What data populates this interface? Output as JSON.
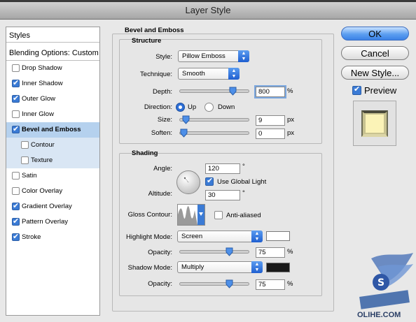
{
  "window": {
    "title": "Layer Style"
  },
  "styles_list": {
    "header": "Styles",
    "blending": "Blending Options: Custom",
    "items": [
      {
        "label": "Drop Shadow",
        "checked": false
      },
      {
        "label": "Inner Shadow",
        "checked": true
      },
      {
        "label": "Outer Glow",
        "checked": true
      },
      {
        "label": "Inner Glow",
        "checked": false
      },
      {
        "label": "Bevel and Emboss",
        "checked": true,
        "selected": true
      },
      {
        "label": "Contour",
        "checked": false,
        "sub": true
      },
      {
        "label": "Texture",
        "checked": false,
        "sub": true
      },
      {
        "label": "Satin",
        "checked": false
      },
      {
        "label": "Color Overlay",
        "checked": false
      },
      {
        "label": "Gradient Overlay",
        "checked": true
      },
      {
        "label": "Pattern Overlay",
        "checked": true
      },
      {
        "label": "Stroke",
        "checked": true
      }
    ]
  },
  "bevel": {
    "section_title": "Bevel and Emboss",
    "structure": {
      "title": "Structure",
      "style_label": "Style:",
      "style_value": "Pillow Emboss",
      "technique_label": "Technique:",
      "technique_value": "Smooth",
      "depth_label": "Depth:",
      "depth_value": "800",
      "depth_unit": "%",
      "depth_slider_fraction": 0.8,
      "direction_label": "Direction:",
      "direction_up": "Up",
      "direction_down": "Down",
      "direction_selected": "Up",
      "size_label": "Size:",
      "size_value": "9",
      "size_unit": "px",
      "size_slider_fraction": 0.04,
      "soften_label": "Soften:",
      "soften_value": "0",
      "soften_unit": "px",
      "soften_slider_fraction": 0.0
    },
    "shading": {
      "title": "Shading",
      "angle_label": "Angle:",
      "angle_value": "120",
      "angle_unit": "°",
      "global_light_label": "Use Global Light",
      "global_light_checked": true,
      "altitude_label": "Altitude:",
      "altitude_value": "30",
      "altitude_unit": "°",
      "gloss_label": "Gloss Contour:",
      "anti_aliased_label": "Anti-aliased",
      "anti_aliased_checked": false,
      "highlight_mode_label": "Highlight Mode:",
      "highlight_mode_value": "Screen",
      "highlight_color": "#ffffff",
      "highlight_opacity_label": "Opacity:",
      "highlight_opacity_value": "75",
      "highlight_opacity_unit": "%",
      "highlight_opacity_fraction": 0.75,
      "shadow_mode_label": "Shadow Mode:",
      "shadow_mode_value": "Multiply",
      "shadow_color": "#1a1a1a",
      "shadow_opacity_label": "Opacity:",
      "shadow_opacity_value": "75",
      "shadow_opacity_unit": "%",
      "shadow_opacity_fraction": 0.75
    }
  },
  "buttons": {
    "ok": "OK",
    "cancel": "Cancel",
    "new_style": "New Style...",
    "preview_label": "Preview",
    "preview_checked": true
  },
  "watermark": {
    "text": "OLIHE.COM"
  },
  "colors": {
    "accent": "#3b7bd5",
    "selection": "#b5d1ee"
  }
}
